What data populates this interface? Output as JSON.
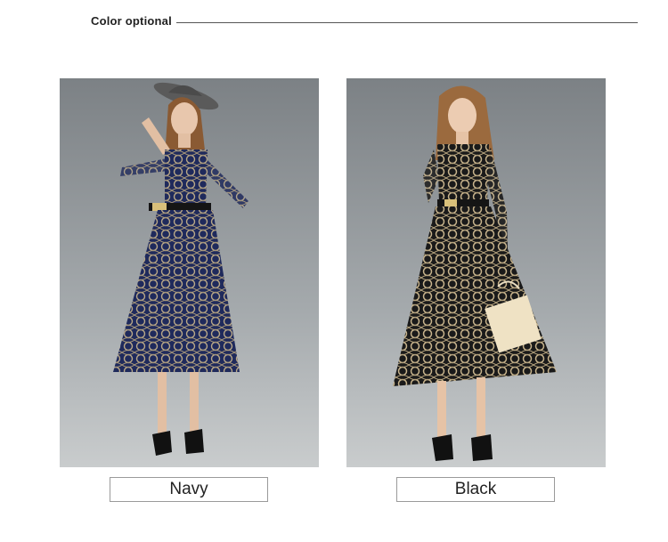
{
  "header": {
    "title": "Color optional"
  },
  "options": [
    {
      "label": "Navy",
      "image_icon": "navy-lace-dress-photo",
      "dress_color": "#1f2a5c",
      "lace_color": "#b9a888"
    },
    {
      "label": "Black",
      "image_icon": "black-lace-dress-photo",
      "dress_color": "#1a1a1a",
      "lace_color": "#c7b38c"
    }
  ],
  "colors": {
    "rule": "#555555",
    "box_border": "#9a9a9a",
    "backdrop": "#8d9396"
  }
}
